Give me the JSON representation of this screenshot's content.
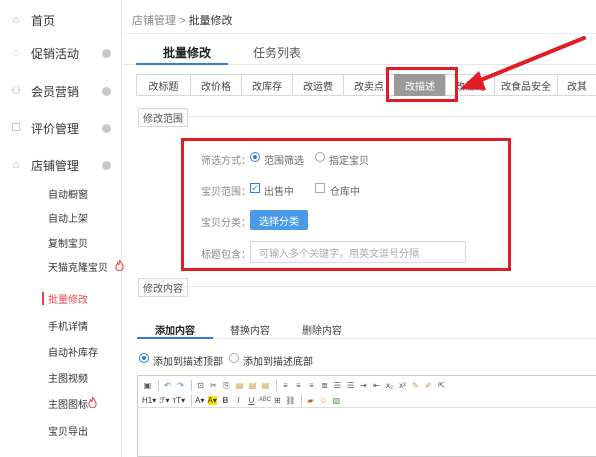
{
  "sidebar": {
    "menus": [
      {
        "label": "首页",
        "icon": "home-icon"
      },
      {
        "label": "促销活动",
        "icon": "tag-icon"
      },
      {
        "label": "会员营销",
        "icon": "user-icon"
      },
      {
        "label": "评价管理",
        "icon": "comment-icon"
      },
      {
        "label": "店铺管理",
        "icon": "store-icon"
      }
    ],
    "sub_items": [
      {
        "label": "自动橱窗"
      },
      {
        "label": "自动上架"
      },
      {
        "label": "复制宝贝"
      },
      {
        "label": "天猫克隆宝贝",
        "hot": true
      },
      {
        "label": "批量修改",
        "active": true
      },
      {
        "label": "手机详情"
      },
      {
        "label": "自动补库存"
      },
      {
        "label": "主图视频"
      },
      {
        "label": "主图图标",
        "hot": true
      },
      {
        "label": "宝贝导出"
      }
    ]
  },
  "breadcrumb": {
    "parent": "店铺管理",
    "separator": ">",
    "current": "批量修改"
  },
  "page_tabs": [
    {
      "label": "批量修改",
      "active": true
    },
    {
      "label": "任务列表"
    }
  ],
  "edit_tabs": [
    "改标题",
    "改价格",
    "改库存",
    "改运费",
    "改卖点",
    "改描述",
    "改编码",
    "改食品安全",
    "改其"
  ],
  "selected_edit_tab": "改描述",
  "range_section": {
    "title": "修改范围",
    "filter_label": "筛选方式：",
    "filter_options": [
      "范围筛选",
      "指定宝贝"
    ],
    "scope_label": "宝贝范围：",
    "scope_options": [
      "出售中",
      "仓库中"
    ],
    "category_label": "宝贝分类：",
    "category_button": "选择分类",
    "keyword_label": "标题包含：",
    "keyword_placeholder": "可输入多个关键字，用英文逗号分隔"
  },
  "content_section": {
    "title": "修改内容",
    "tabs": [
      "添加内容",
      "替换内容",
      "删除内容"
    ],
    "positions": [
      "添加到描述顶部",
      "添加到描述底部"
    ],
    "toolbar_text": {
      "heading": "H1",
      "font": "ℱ",
      "size": "тT",
      "font_color": "A",
      "bg_color": "A"
    }
  },
  "colors": {
    "accent": "#2f7fd8",
    "highlight": "#e01c25",
    "hot": "#f04848",
    "tab_selected": "#9a9a9a"
  }
}
